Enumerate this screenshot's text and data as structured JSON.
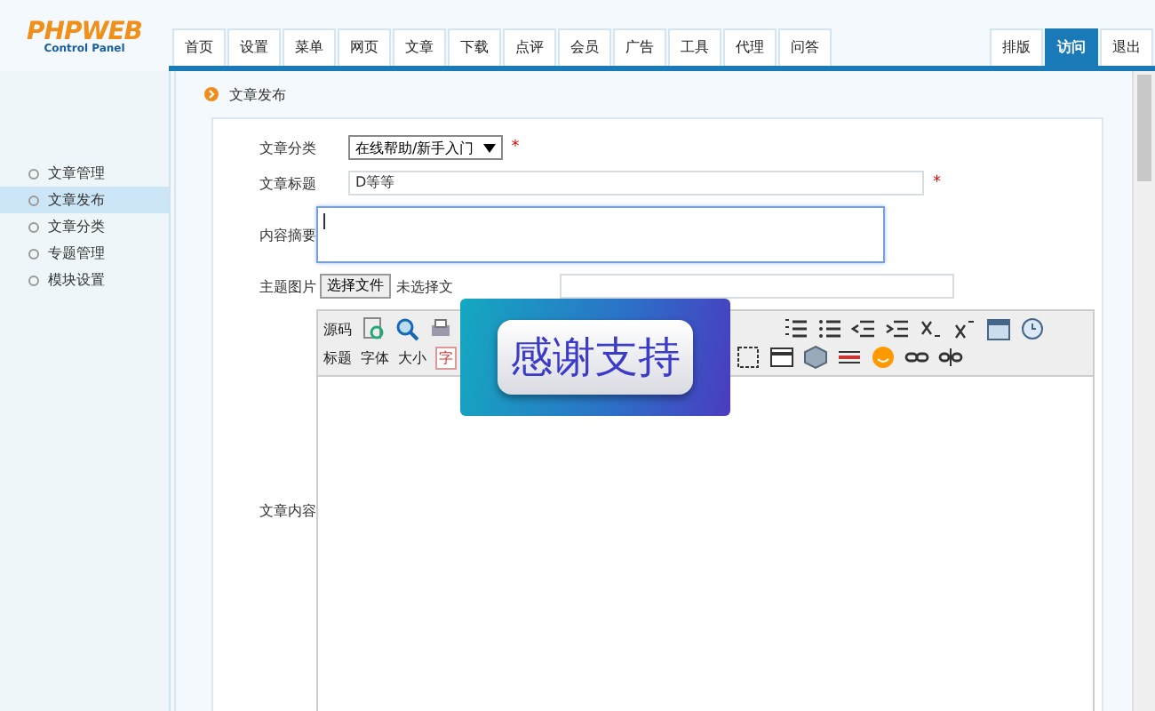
{
  "logo": {
    "title": "PHPWEB",
    "subtitle": "Control Panel"
  },
  "nav_tabs": [
    {
      "label": "首页",
      "selected": false
    },
    {
      "label": "设置",
      "selected": false
    },
    {
      "label": "菜单",
      "selected": false
    },
    {
      "label": "网页",
      "selected": false
    },
    {
      "label": "文章",
      "selected": false
    },
    {
      "label": "下载",
      "selected": false
    },
    {
      "label": "点评",
      "selected": false
    },
    {
      "label": "会员",
      "selected": false
    },
    {
      "label": "广告",
      "selected": false
    },
    {
      "label": "工具",
      "selected": false
    },
    {
      "label": "代理",
      "selected": false
    },
    {
      "label": "问答",
      "selected": false
    }
  ],
  "right_tabs": [
    {
      "label": "排版",
      "selected": false
    },
    {
      "label": "访问",
      "selected": true
    },
    {
      "label": "退出",
      "selected": false
    }
  ],
  "sidebar": {
    "items": [
      {
        "label": "文章管理",
        "selected": false
      },
      {
        "label": "文章发布",
        "selected": true
      },
      {
        "label": "文章分类",
        "selected": false
      },
      {
        "label": "专题管理",
        "selected": false
      },
      {
        "label": "模块设置",
        "selected": false
      }
    ]
  },
  "breadcrumb": "文章发布",
  "form": {
    "category": {
      "label": "文章分类",
      "value": "在线帮助/新手入门",
      "required_mark": "*"
    },
    "title": {
      "label": "文章标题",
      "value": "D等等",
      "required_mark": "*"
    },
    "summary": {
      "label": "内容摘要"
    },
    "image": {
      "label": "主题图片",
      "button": "选择文件",
      "status": "未选择文"
    },
    "content": {
      "label": "文章内容",
      "toolbar_row_1": [
        "源码"
      ],
      "toolbar_row_2": [
        "标题",
        "字体",
        "大小",
        "字"
      ]
    }
  },
  "overlay": {
    "text": "感谢支持"
  }
}
